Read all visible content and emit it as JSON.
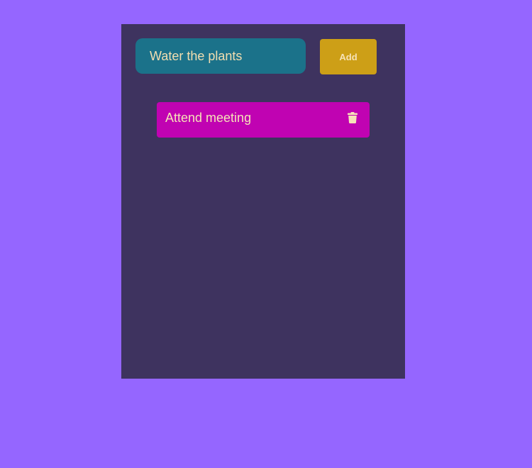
{
  "todo": {
    "input": {
      "value": "Water the plants",
      "placeholder": ""
    },
    "add_label": "Add",
    "tasks": [
      {
        "label": "Attend meeting",
        "icon": "trash-icon"
      }
    ]
  },
  "colors": {
    "background": "#9566ff",
    "panel": "#3e335f",
    "input": "#1b728a",
    "add_button": "#cd9f17",
    "task_item": "#c003b2",
    "text": "#f6e2b8"
  }
}
